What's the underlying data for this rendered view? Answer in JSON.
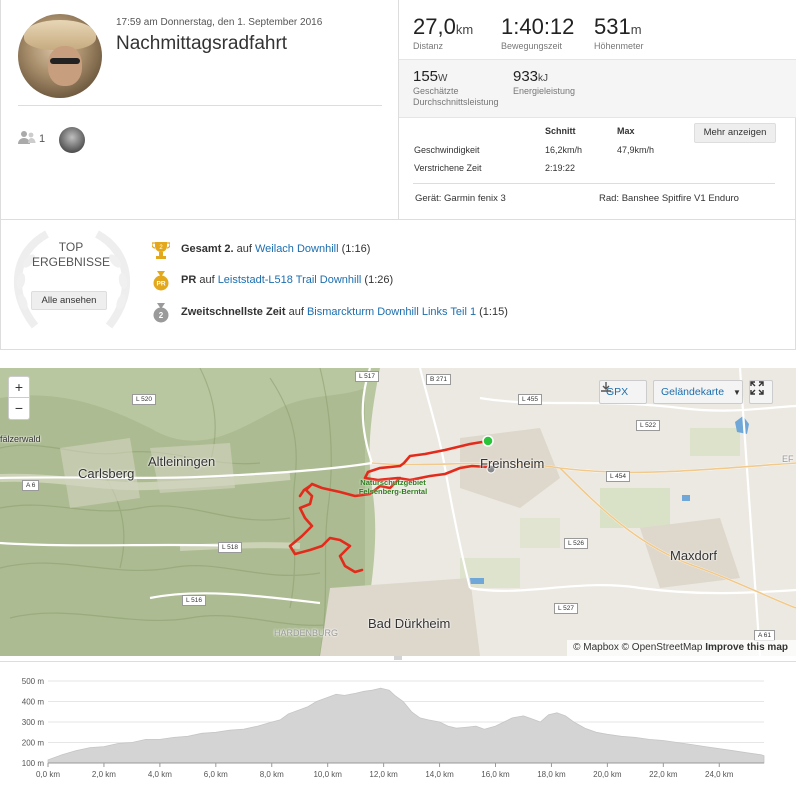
{
  "activity": {
    "datetime": "17:59 am Donnerstag, den 1. September 2016",
    "title": "Nachmittagsradfahrt",
    "kudos_count": "1"
  },
  "stats": {
    "distance": {
      "value": "27,0",
      "unit": "km",
      "label": "Distanz"
    },
    "moving_time": {
      "value": "1:40:12",
      "label": "Bewegungszeit"
    },
    "elevation": {
      "value": "531",
      "unit": "m",
      "label": "Höhenmeter"
    },
    "power": {
      "value": "155",
      "unit": "W",
      "label_line1": "Geschätzte",
      "label_line2": "Durchschnittsleistung"
    },
    "energy": {
      "value": "933",
      "unit": "kJ",
      "label": "Energieleistung"
    }
  },
  "details": {
    "col_avg": "Schnitt",
    "col_max": "Max",
    "rows": [
      {
        "label": "Geschwindigkeit",
        "avg": "16,2km/h",
        "max": "47,9km/h"
      },
      {
        "label": "Verstrichene Zeit",
        "avg": "2:19:22",
        "max": ""
      }
    ],
    "more_button": "Mehr anzeigen",
    "device": "Gerät: Garmin fenix 3",
    "bike": "Rad: Banshee Spitfire V1 Enduro"
  },
  "top_results": {
    "title_line1": "TOP",
    "title_line2": "ERGEBNISSE",
    "see_all": "Alle ansehen",
    "items": [
      {
        "medal": "2",
        "bold": "Gesamt 2.",
        "pre": " auf ",
        "link": "Weilach Downhill",
        "time": " (1:16)",
        "color": "#e3a81c"
      },
      {
        "medal": "PR",
        "bold": "PR",
        "pre": " auf ",
        "link": "Leiststadt-L518 Trail Downhill",
        "time": " (1:26)",
        "color": "#e3a81c"
      },
      {
        "medal": "2",
        "bold": "Zweitschnellste Zeit",
        "pre": " auf ",
        "link": "Bismarckturm Downhill Links Teil 1",
        "time": " (1:15)",
        "color": "#9a9a9a"
      }
    ]
  },
  "map": {
    "zoom_in": "+",
    "zoom_out": "−",
    "gpx_label": "GPX",
    "map_type": "Geländekarte",
    "attribution_mapbox": "© Mapbox",
    "attribution_osm": "© OpenStreetMap",
    "attribution_improve": "Improve this map",
    "places": {
      "carlsberg": "Carlsberg",
      "altleiningen": "Altleiningen",
      "freinsheim": "Freinsheim",
      "maxdorf": "Maxdorf",
      "bad_duerkheim": "Bad Dürkheim",
      "hardenburg": "HARDENBURG",
      "pfaelzerwald": "fälzerwald",
      "ef": "EF",
      "nature_reserve": "Naturschutzgebiet Felsenberg-Berntal"
    },
    "roads": [
      "L 517",
      "B 271",
      "L 520",
      "L 455",
      "L 522",
      "L 454",
      "A 6",
      "L 526",
      "L 518",
      "L 516",
      "L 527",
      "A 61"
    ],
    "route_color": "#e32b1c"
  },
  "elevation": {
    "y_ticks": [
      "500 m",
      "400 m",
      "300 m",
      "200 m",
      "100 m"
    ],
    "x_ticks": [
      "0,0 km",
      "2,0 km",
      "4,0 km",
      "6,0 km",
      "8,0 km",
      "10,0 km",
      "12,0 km",
      "14,0 km",
      "16,0 km",
      "18,0 km",
      "20,0 km",
      "22,0 km",
      "24,0 km"
    ],
    "ylim": [
      100,
      500
    ],
    "xlim": [
      0,
      25.6
    ],
    "profile": [
      [
        0,
        115
      ],
      [
        0.5,
        140
      ],
      [
        1,
        160
      ],
      [
        1.5,
        175
      ],
      [
        2,
        180
      ],
      [
        2.5,
        195
      ],
      [
        3,
        200
      ],
      [
        3.5,
        215
      ],
      [
        4,
        215
      ],
      [
        4.5,
        225
      ],
      [
        5,
        230
      ],
      [
        5.5,
        245
      ],
      [
        6,
        250
      ],
      [
        6.5,
        260
      ],
      [
        7,
        265
      ],
      [
        7.5,
        280
      ],
      [
        8,
        300
      ],
      [
        8.3,
        310
      ],
      [
        8.6,
        340
      ],
      [
        9,
        360
      ],
      [
        9.3,
        375
      ],
      [
        9.6,
        400
      ],
      [
        10,
        420
      ],
      [
        10.3,
        435
      ],
      [
        10.6,
        430
      ],
      [
        11,
        440
      ],
      [
        11.3,
        450
      ],
      [
        11.6,
        455
      ],
      [
        11.9,
        465
      ],
      [
        12.2,
        455
      ],
      [
        12.4,
        430
      ],
      [
        12.7,
        400
      ],
      [
        13,
        350
      ],
      [
        13.3,
        320
      ],
      [
        13.6,
        310
      ],
      [
        14,
        300
      ],
      [
        14.3,
        280
      ],
      [
        14.6,
        270
      ],
      [
        15,
        275
      ],
      [
        15.3,
        280
      ],
      [
        15.6,
        265
      ],
      [
        16,
        280
      ],
      [
        16.3,
        300
      ],
      [
        16.6,
        320
      ],
      [
        17,
        330
      ],
      [
        17.3,
        315
      ],
      [
        17.6,
        300
      ],
      [
        17.9,
        335
      ],
      [
        18.2,
        345
      ],
      [
        18.5,
        330
      ],
      [
        18.8,
        300
      ],
      [
        19.2,
        270
      ],
      [
        19.6,
        250
      ],
      [
        20,
        240
      ],
      [
        20.5,
        230
      ],
      [
        21,
        225
      ],
      [
        21.5,
        215
      ],
      [
        22,
        210
      ],
      [
        22.5,
        200
      ],
      [
        23,
        190
      ],
      [
        23.5,
        180
      ],
      [
        24,
        170
      ],
      [
        24.5,
        160
      ],
      [
        25,
        150
      ],
      [
        25.5,
        140
      ],
      [
        25.6,
        135
      ]
    ]
  }
}
